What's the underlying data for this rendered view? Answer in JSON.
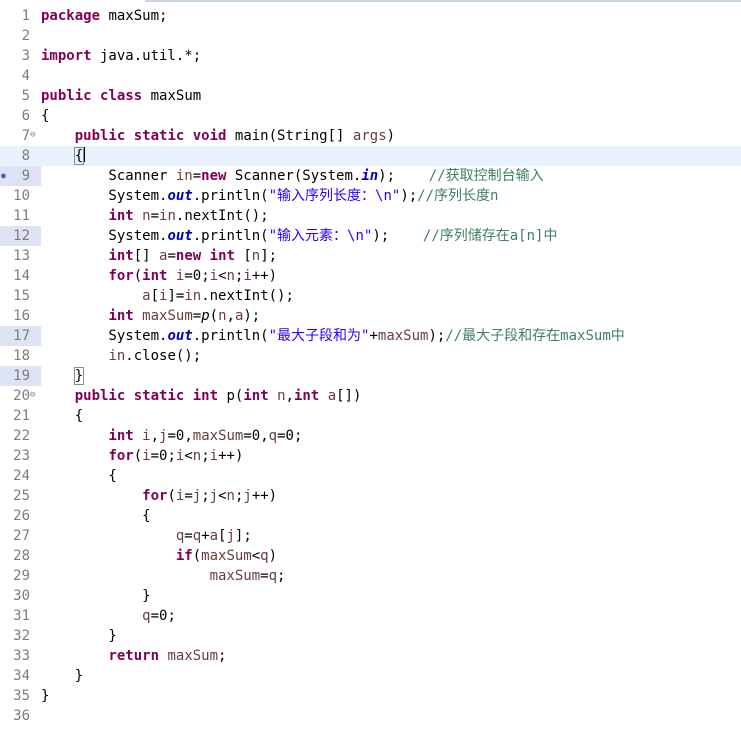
{
  "editor": {
    "current_line": 8,
    "lines": [
      {
        "n": "1",
        "tokens": [
          {
            "t": "package",
            "c": "kw"
          },
          {
            "t": " maxSum;"
          }
        ]
      },
      {
        "n": "2",
        "tokens": []
      },
      {
        "n": "3",
        "tokens": [
          {
            "t": "import",
            "c": "kw"
          },
          {
            "t": " java.util.*;"
          }
        ]
      },
      {
        "n": "4",
        "tokens": []
      },
      {
        "n": "5",
        "tokens": [
          {
            "t": "public",
            "c": "kw"
          },
          {
            "t": " "
          },
          {
            "t": "class",
            "c": "kw"
          },
          {
            "t": " maxSum"
          }
        ]
      },
      {
        "n": "6",
        "tokens": [
          {
            "t": "{"
          }
        ]
      },
      {
        "n": "7",
        "fold": true,
        "tokens": [
          {
            "t": "    "
          },
          {
            "t": "public",
            "c": "kw"
          },
          {
            "t": " "
          },
          {
            "t": "static",
            "c": "kw"
          },
          {
            "t": " "
          },
          {
            "t": "void",
            "c": "kw"
          },
          {
            "t": " main(String[] "
          },
          {
            "t": "args",
            "c": "loc"
          },
          {
            "t": ")"
          }
        ]
      },
      {
        "n": "8",
        "tokens": [
          {
            "t": "    "
          },
          {
            "t": "{",
            "c": "brace-box"
          },
          {
            "t": "",
            "c": "caret"
          }
        ]
      },
      {
        "n": "9",
        "bp": true,
        "marked": true,
        "tokens": [
          {
            "t": "        Scanner "
          },
          {
            "t": "in",
            "c": "loc"
          },
          {
            "t": "="
          },
          {
            "t": "new",
            "c": "kw"
          },
          {
            "t": " Scanner(System."
          },
          {
            "t": "in",
            "c": "fld"
          },
          {
            "t": ");    "
          },
          {
            "t": "//获取控制台输入",
            "c": "cmt"
          }
        ]
      },
      {
        "n": "10",
        "tokens": [
          {
            "t": "        System."
          },
          {
            "t": "out",
            "c": "fld"
          },
          {
            "t": ".println("
          },
          {
            "t": "\"输入序列长度：\\n\"",
            "c": "str"
          },
          {
            "t": ");"
          },
          {
            "t": "//序列长度n",
            "c": "cmt"
          }
        ]
      },
      {
        "n": "11",
        "tokens": [
          {
            "t": "        "
          },
          {
            "t": "int",
            "c": "kw"
          },
          {
            "t": " "
          },
          {
            "t": "n",
            "c": "loc"
          },
          {
            "t": "="
          },
          {
            "t": "in",
            "c": "loc"
          },
          {
            "t": ".nextInt();"
          }
        ]
      },
      {
        "n": "12",
        "marked": true,
        "tokens": [
          {
            "t": "        System."
          },
          {
            "t": "out",
            "c": "fld"
          },
          {
            "t": ".println("
          },
          {
            "t": "\"输入元素：\\n\"",
            "c": "str"
          },
          {
            "t": ");    "
          },
          {
            "t": "//序列储存在a[n]中",
            "c": "cmt"
          }
        ]
      },
      {
        "n": "13",
        "tokens": [
          {
            "t": "        "
          },
          {
            "t": "int",
            "c": "kw"
          },
          {
            "t": "[] "
          },
          {
            "t": "a",
            "c": "loc"
          },
          {
            "t": "="
          },
          {
            "t": "new",
            "c": "kw"
          },
          {
            "t": " "
          },
          {
            "t": "int",
            "c": "kw"
          },
          {
            "t": " ["
          },
          {
            "t": "n",
            "c": "loc"
          },
          {
            "t": "];"
          }
        ]
      },
      {
        "n": "14",
        "tokens": [
          {
            "t": "        "
          },
          {
            "t": "for",
            "c": "kw"
          },
          {
            "t": "("
          },
          {
            "t": "int",
            "c": "kw"
          },
          {
            "t": " "
          },
          {
            "t": "i",
            "c": "loc"
          },
          {
            "t": "=0;"
          },
          {
            "t": "i",
            "c": "loc"
          },
          {
            "t": "<"
          },
          {
            "t": "n",
            "c": "loc"
          },
          {
            "t": ";"
          },
          {
            "t": "i",
            "c": "loc"
          },
          {
            "t": "++)"
          }
        ]
      },
      {
        "n": "15",
        "tokens": [
          {
            "t": "            "
          },
          {
            "t": "a",
            "c": "loc"
          },
          {
            "t": "["
          },
          {
            "t": "i",
            "c": "loc"
          },
          {
            "t": "]="
          },
          {
            "t": "in",
            "c": "loc"
          },
          {
            "t": ".nextInt();"
          }
        ]
      },
      {
        "n": "16",
        "tokens": [
          {
            "t": "        "
          },
          {
            "t": "int",
            "c": "kw"
          },
          {
            "t": " "
          },
          {
            "t": "maxSum",
            "c": "loc"
          },
          {
            "t": "="
          },
          {
            "t": "p",
            "c": "mth"
          },
          {
            "t": "("
          },
          {
            "t": "n",
            "c": "loc"
          },
          {
            "t": ","
          },
          {
            "t": "a",
            "c": "loc"
          },
          {
            "t": ");"
          }
        ]
      },
      {
        "n": "17",
        "marked": true,
        "tokens": [
          {
            "t": "        System."
          },
          {
            "t": "out",
            "c": "fld"
          },
          {
            "t": ".println("
          },
          {
            "t": "\"最大子段和为\"",
            "c": "str"
          },
          {
            "t": "+"
          },
          {
            "t": "maxSum",
            "c": "loc"
          },
          {
            "t": ");"
          },
          {
            "t": "//最大子段和存在maxSum中",
            "c": "cmt"
          }
        ]
      },
      {
        "n": "18",
        "tokens": [
          {
            "t": "        "
          },
          {
            "t": "in",
            "c": "loc"
          },
          {
            "t": ".close();"
          }
        ]
      },
      {
        "n": "19",
        "marked": true,
        "tokens": [
          {
            "t": "    "
          },
          {
            "t": "}",
            "c": "brace-box"
          }
        ]
      },
      {
        "n": "20",
        "fold": true,
        "tokens": [
          {
            "t": "    "
          },
          {
            "t": "public",
            "c": "kw"
          },
          {
            "t": " "
          },
          {
            "t": "static",
            "c": "kw"
          },
          {
            "t": " "
          },
          {
            "t": "int",
            "c": "kw"
          },
          {
            "t": " p("
          },
          {
            "t": "int",
            "c": "kw"
          },
          {
            "t": " "
          },
          {
            "t": "n",
            "c": "loc"
          },
          {
            "t": ","
          },
          {
            "t": "int",
            "c": "kw"
          },
          {
            "t": " "
          },
          {
            "t": "a",
            "c": "loc"
          },
          {
            "t": "[])"
          }
        ]
      },
      {
        "n": "21",
        "tokens": [
          {
            "t": "    {"
          }
        ]
      },
      {
        "n": "22",
        "tokens": [
          {
            "t": "        "
          },
          {
            "t": "int",
            "c": "kw"
          },
          {
            "t": " "
          },
          {
            "t": "i",
            "c": "loc"
          },
          {
            "t": ","
          },
          {
            "t": "j",
            "c": "loc"
          },
          {
            "t": "=0,"
          },
          {
            "t": "maxSum",
            "c": "loc"
          },
          {
            "t": "=0,"
          },
          {
            "t": "q",
            "c": "loc"
          },
          {
            "t": "=0;"
          }
        ]
      },
      {
        "n": "23",
        "tokens": [
          {
            "t": "        "
          },
          {
            "t": "for",
            "c": "kw"
          },
          {
            "t": "("
          },
          {
            "t": "i",
            "c": "loc"
          },
          {
            "t": "=0;"
          },
          {
            "t": "i",
            "c": "loc"
          },
          {
            "t": "<"
          },
          {
            "t": "n",
            "c": "loc"
          },
          {
            "t": ";"
          },
          {
            "t": "i",
            "c": "loc"
          },
          {
            "t": "++)"
          }
        ]
      },
      {
        "n": "24",
        "tokens": [
          {
            "t": "        {"
          }
        ]
      },
      {
        "n": "25",
        "tokens": [
          {
            "t": "            "
          },
          {
            "t": "for",
            "c": "kw"
          },
          {
            "t": "("
          },
          {
            "t": "i",
            "c": "loc"
          },
          {
            "t": "="
          },
          {
            "t": "j",
            "c": "loc"
          },
          {
            "t": ";"
          },
          {
            "t": "j",
            "c": "loc"
          },
          {
            "t": "<"
          },
          {
            "t": "n",
            "c": "loc"
          },
          {
            "t": ";"
          },
          {
            "t": "j",
            "c": "loc"
          },
          {
            "t": "++)"
          }
        ]
      },
      {
        "n": "26",
        "tokens": [
          {
            "t": "            {"
          }
        ]
      },
      {
        "n": "27",
        "tokens": [
          {
            "t": "                "
          },
          {
            "t": "q",
            "c": "loc"
          },
          {
            "t": "="
          },
          {
            "t": "q",
            "c": "loc"
          },
          {
            "t": "+"
          },
          {
            "t": "a",
            "c": "loc"
          },
          {
            "t": "["
          },
          {
            "t": "j",
            "c": "loc"
          },
          {
            "t": "];"
          }
        ]
      },
      {
        "n": "28",
        "tokens": [
          {
            "t": "                "
          },
          {
            "t": "if",
            "c": "kw"
          },
          {
            "t": "("
          },
          {
            "t": "maxSum",
            "c": "loc"
          },
          {
            "t": "<"
          },
          {
            "t": "q",
            "c": "loc"
          },
          {
            "t": ")"
          }
        ]
      },
      {
        "n": "29",
        "tokens": [
          {
            "t": "                    "
          },
          {
            "t": "maxSum",
            "c": "loc"
          },
          {
            "t": "="
          },
          {
            "t": "q",
            "c": "loc"
          },
          {
            "t": ";"
          }
        ]
      },
      {
        "n": "30",
        "tokens": [
          {
            "t": "            }"
          }
        ]
      },
      {
        "n": "31",
        "tokens": [
          {
            "t": "            "
          },
          {
            "t": "q",
            "c": "loc"
          },
          {
            "t": "=0;"
          }
        ]
      },
      {
        "n": "32",
        "tokens": [
          {
            "t": "        }"
          }
        ]
      },
      {
        "n": "33",
        "tokens": [
          {
            "t": "        "
          },
          {
            "t": "return",
            "c": "kw"
          },
          {
            "t": " "
          },
          {
            "t": "maxSum",
            "c": "loc"
          },
          {
            "t": ";"
          }
        ]
      },
      {
        "n": "34",
        "tokens": [
          {
            "t": "    }"
          }
        ]
      },
      {
        "n": "35",
        "tokens": [
          {
            "t": "}"
          }
        ]
      },
      {
        "n": "36",
        "tokens": []
      }
    ]
  }
}
